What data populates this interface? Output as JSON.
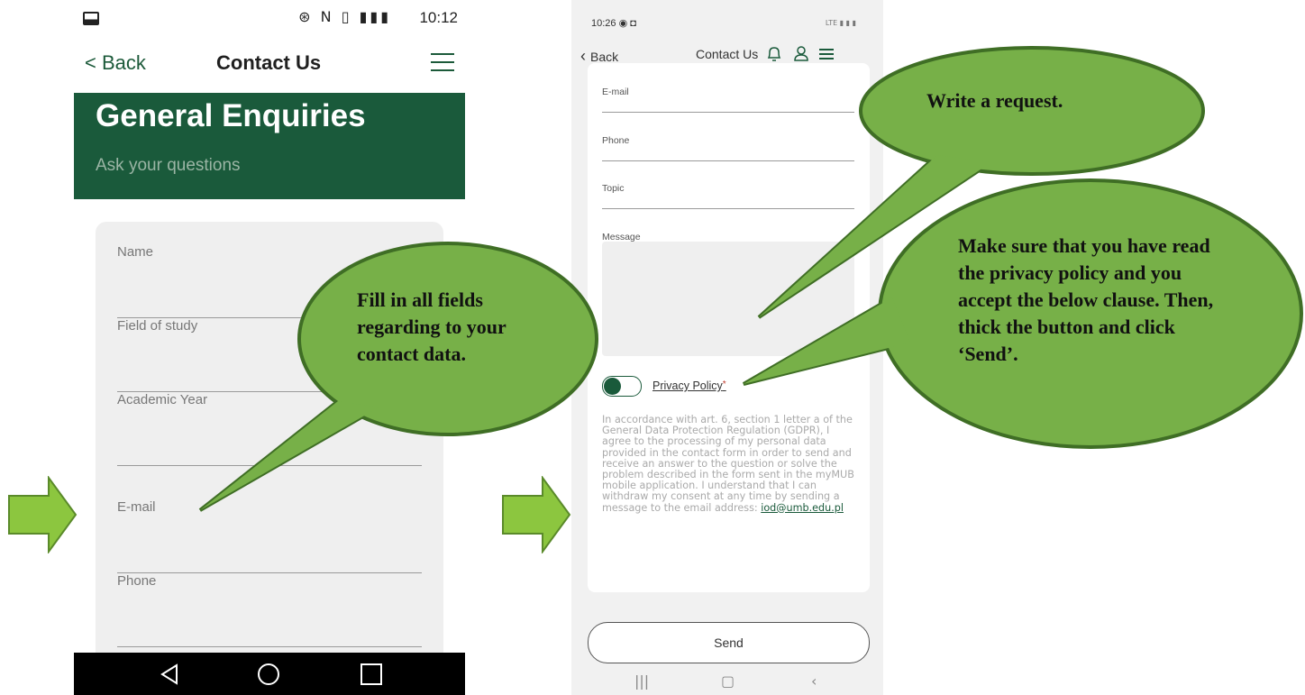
{
  "left_phone": {
    "status": {
      "time": "10:12",
      "icons": "⊛ N ▯ ▮▮▮"
    },
    "header": {
      "back_label": "< Back",
      "title": "Contact Us"
    },
    "hero": {
      "title": "General Enquiries",
      "subtitle": "Ask your questions"
    },
    "fields": [
      "Name",
      "Field of study",
      "Academic Year",
      "E-mail",
      "Phone"
    ]
  },
  "right_phone": {
    "status": {
      "time": "10:26",
      "right": "LTE ▮ ▮ ▮"
    },
    "header": {
      "back_label": "Back",
      "title": "Contact Us"
    },
    "fields": [
      "E-mail",
      "Phone",
      "Topic",
      "Message"
    ],
    "privacy_label": "Privacy Policy",
    "required_mark": "*",
    "consent_text": "In accordance with art. 6, section 1 letter a of the General Data Protection Regulation (GDPR), I agree to the processing of my personal data provided in the contact form in order to send and receive an answer to the question or solve the problem described in the form sent in the myMUB mobile application.  I understand that I can withdraw my consent at any time by sending a message to the email address:",
    "consent_email": "iod@umb.edu.pl",
    "send_label": "Send"
  },
  "callouts": {
    "left": "Fill in all fields regarding to your contact data.",
    "top_right": "Write a request.",
    "bottom_right": "Make sure that you have read the privacy policy and you accept the below clause. Then, thick the button and click ‘Send’."
  },
  "colors": {
    "brand_green": "#1a5a3b",
    "callout_fill": "#77b048",
    "callout_border": "#3f6e25",
    "arrow_fill": "#8cc63f"
  }
}
